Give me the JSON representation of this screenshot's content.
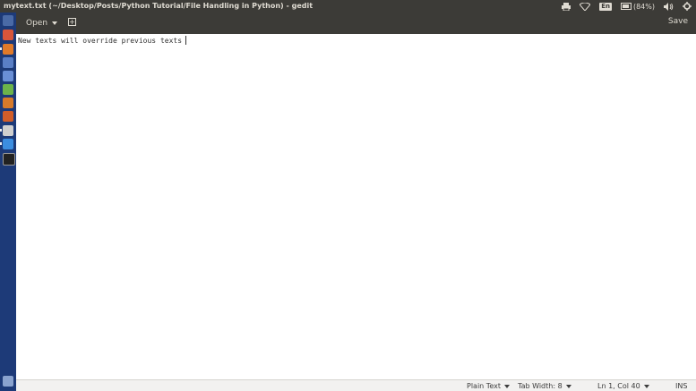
{
  "window": {
    "title": "mytext.txt (~/Desktop/Posts/Python Tutorial/File Handling in Python) - gedit"
  },
  "panel": {
    "keyboard_layout": "En",
    "battery_text": "(84%)",
    "battery_level": 0.84
  },
  "launcher": {
    "items": [
      "search-dash",
      "files",
      "firefox",
      "thunderbird",
      "libreoffice-writer",
      "libreoffice-calc",
      "libreoffice-impress",
      "software-center",
      "amazon",
      "text-editor",
      "chrome",
      "screenshot",
      "trash"
    ]
  },
  "toolbar": {
    "open_label": "Open",
    "save_label": "Save"
  },
  "editor": {
    "content": "New texts will override previous texts"
  },
  "statusbar": {
    "language": "Plain Text",
    "tab_width": "Tab Width: 8",
    "position": "Ln 1, Col 40",
    "mode": "INS"
  }
}
